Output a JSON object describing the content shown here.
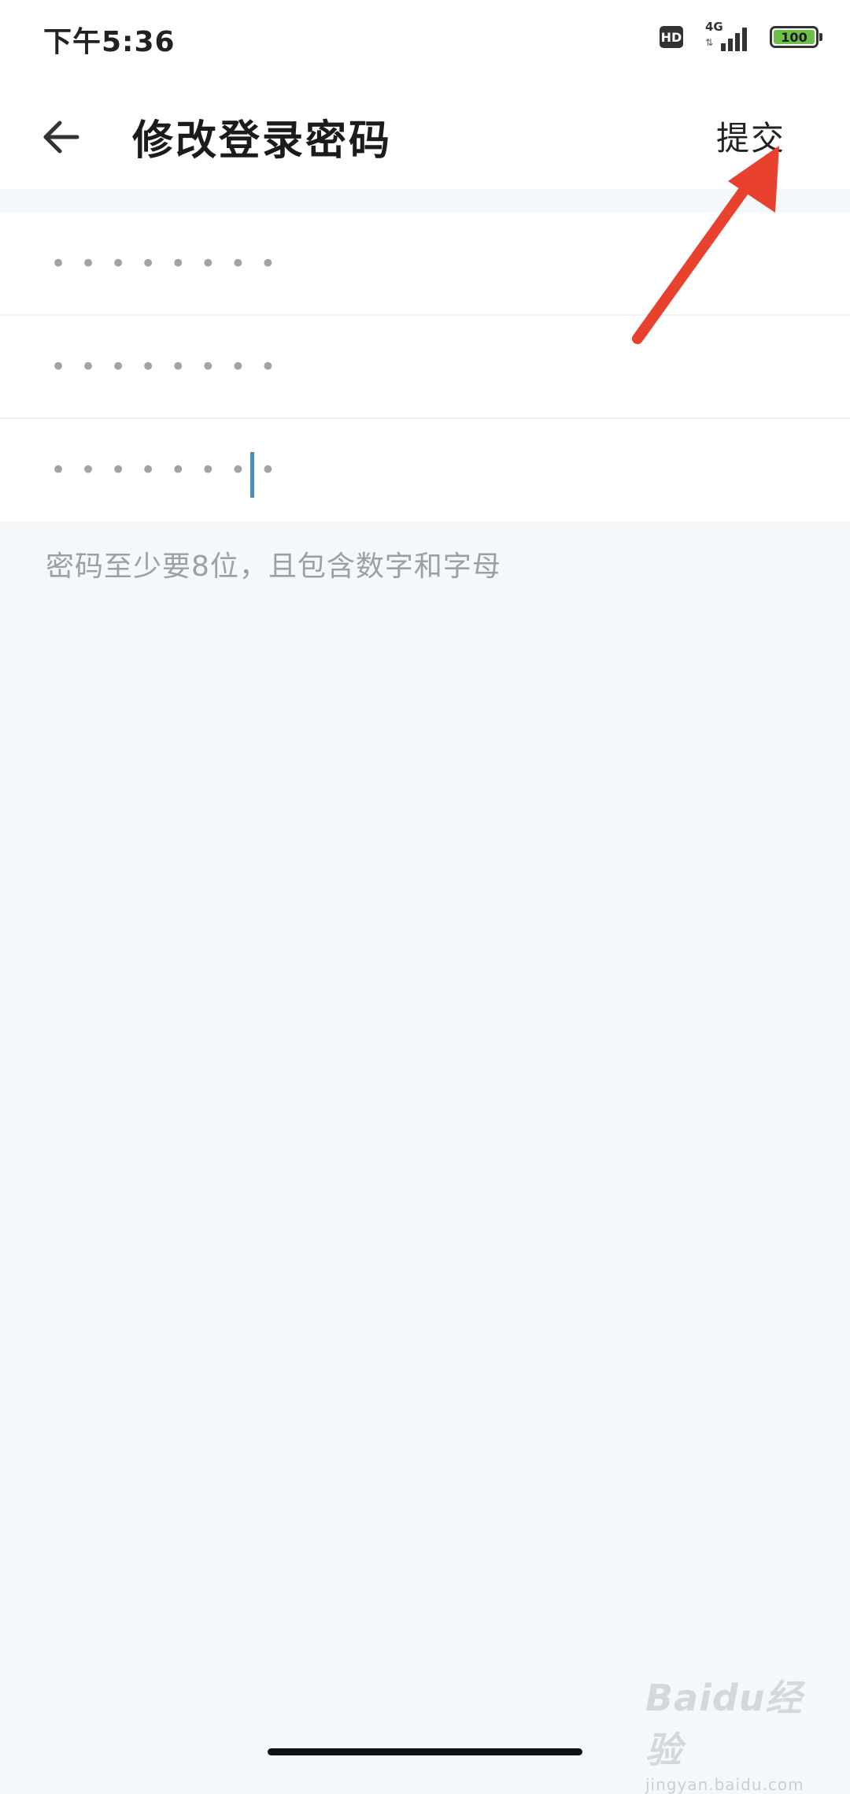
{
  "status_bar": {
    "time": "下午5:36",
    "hd_badge": "HD",
    "network": "4G",
    "network_arrows": "⇅",
    "battery_level": "100",
    "battery_color": "#6cc04a"
  },
  "header": {
    "back_icon": "arrow-left-icon",
    "title": "修改登录密码",
    "submit_label": "提交"
  },
  "fields": [
    {
      "masked_value": "••••••••"
    },
    {
      "masked_value": "••••••••"
    },
    {
      "masked_value": "••••••••",
      "focused": true
    }
  ],
  "hint": "密码至少要8位，且包含数字和字母",
  "annotation": {
    "arrow_color": "#e8412e"
  },
  "watermark": {
    "logo": "Baidu经验",
    "domain": "jingyan.baidu.com"
  }
}
